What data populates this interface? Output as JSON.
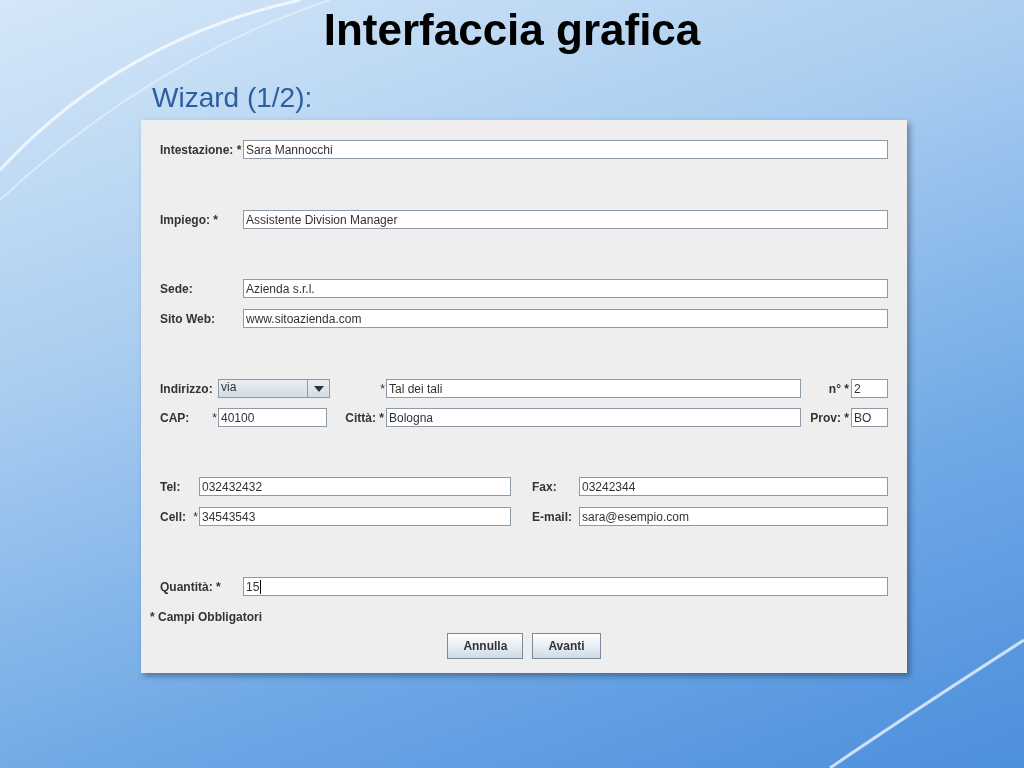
{
  "slide": {
    "title": "Interfaccia grafica",
    "subtitle": "Wizard (1/2):"
  },
  "form": {
    "intestazione": {
      "label": "Intestazione: *",
      "value": "Sara Mannocchi"
    },
    "impiego": {
      "label": "Impiego: *",
      "value": "Assistente Division Manager"
    },
    "sede": {
      "label": "Sede:",
      "value": "Azienda s.r.l."
    },
    "sito_web": {
      "label": "Sito Web:",
      "value": "www.sitoazienda.com"
    },
    "indirizzo": {
      "label": "Indirizzo:",
      "type_value": "via",
      "street_mark": "*",
      "street": "Tal dei tali",
      "number_label": "n° *",
      "number": "2"
    },
    "cap_row": {
      "cap_label": "CAP:",
      "cap_mark": "*",
      "cap": "40100",
      "city_label": "Città: *",
      "city": "Bologna",
      "prov_label": "Prov: *",
      "prov": "BO"
    },
    "tel": {
      "label": "Tel:",
      "value": "032432432"
    },
    "fax": {
      "label": "Fax:",
      "value": "03242344"
    },
    "cell": {
      "label": "Cell:",
      "mark": "*",
      "value": "34543543"
    },
    "email": {
      "label": "E-mail:",
      "value": "sara@esempio.com"
    },
    "quantita": {
      "label": "Quantità: *",
      "value": "15",
      "focused": true
    },
    "note": "* Campi Obbligatori",
    "buttons": [
      "Annulla",
      "Avanti"
    ]
  }
}
